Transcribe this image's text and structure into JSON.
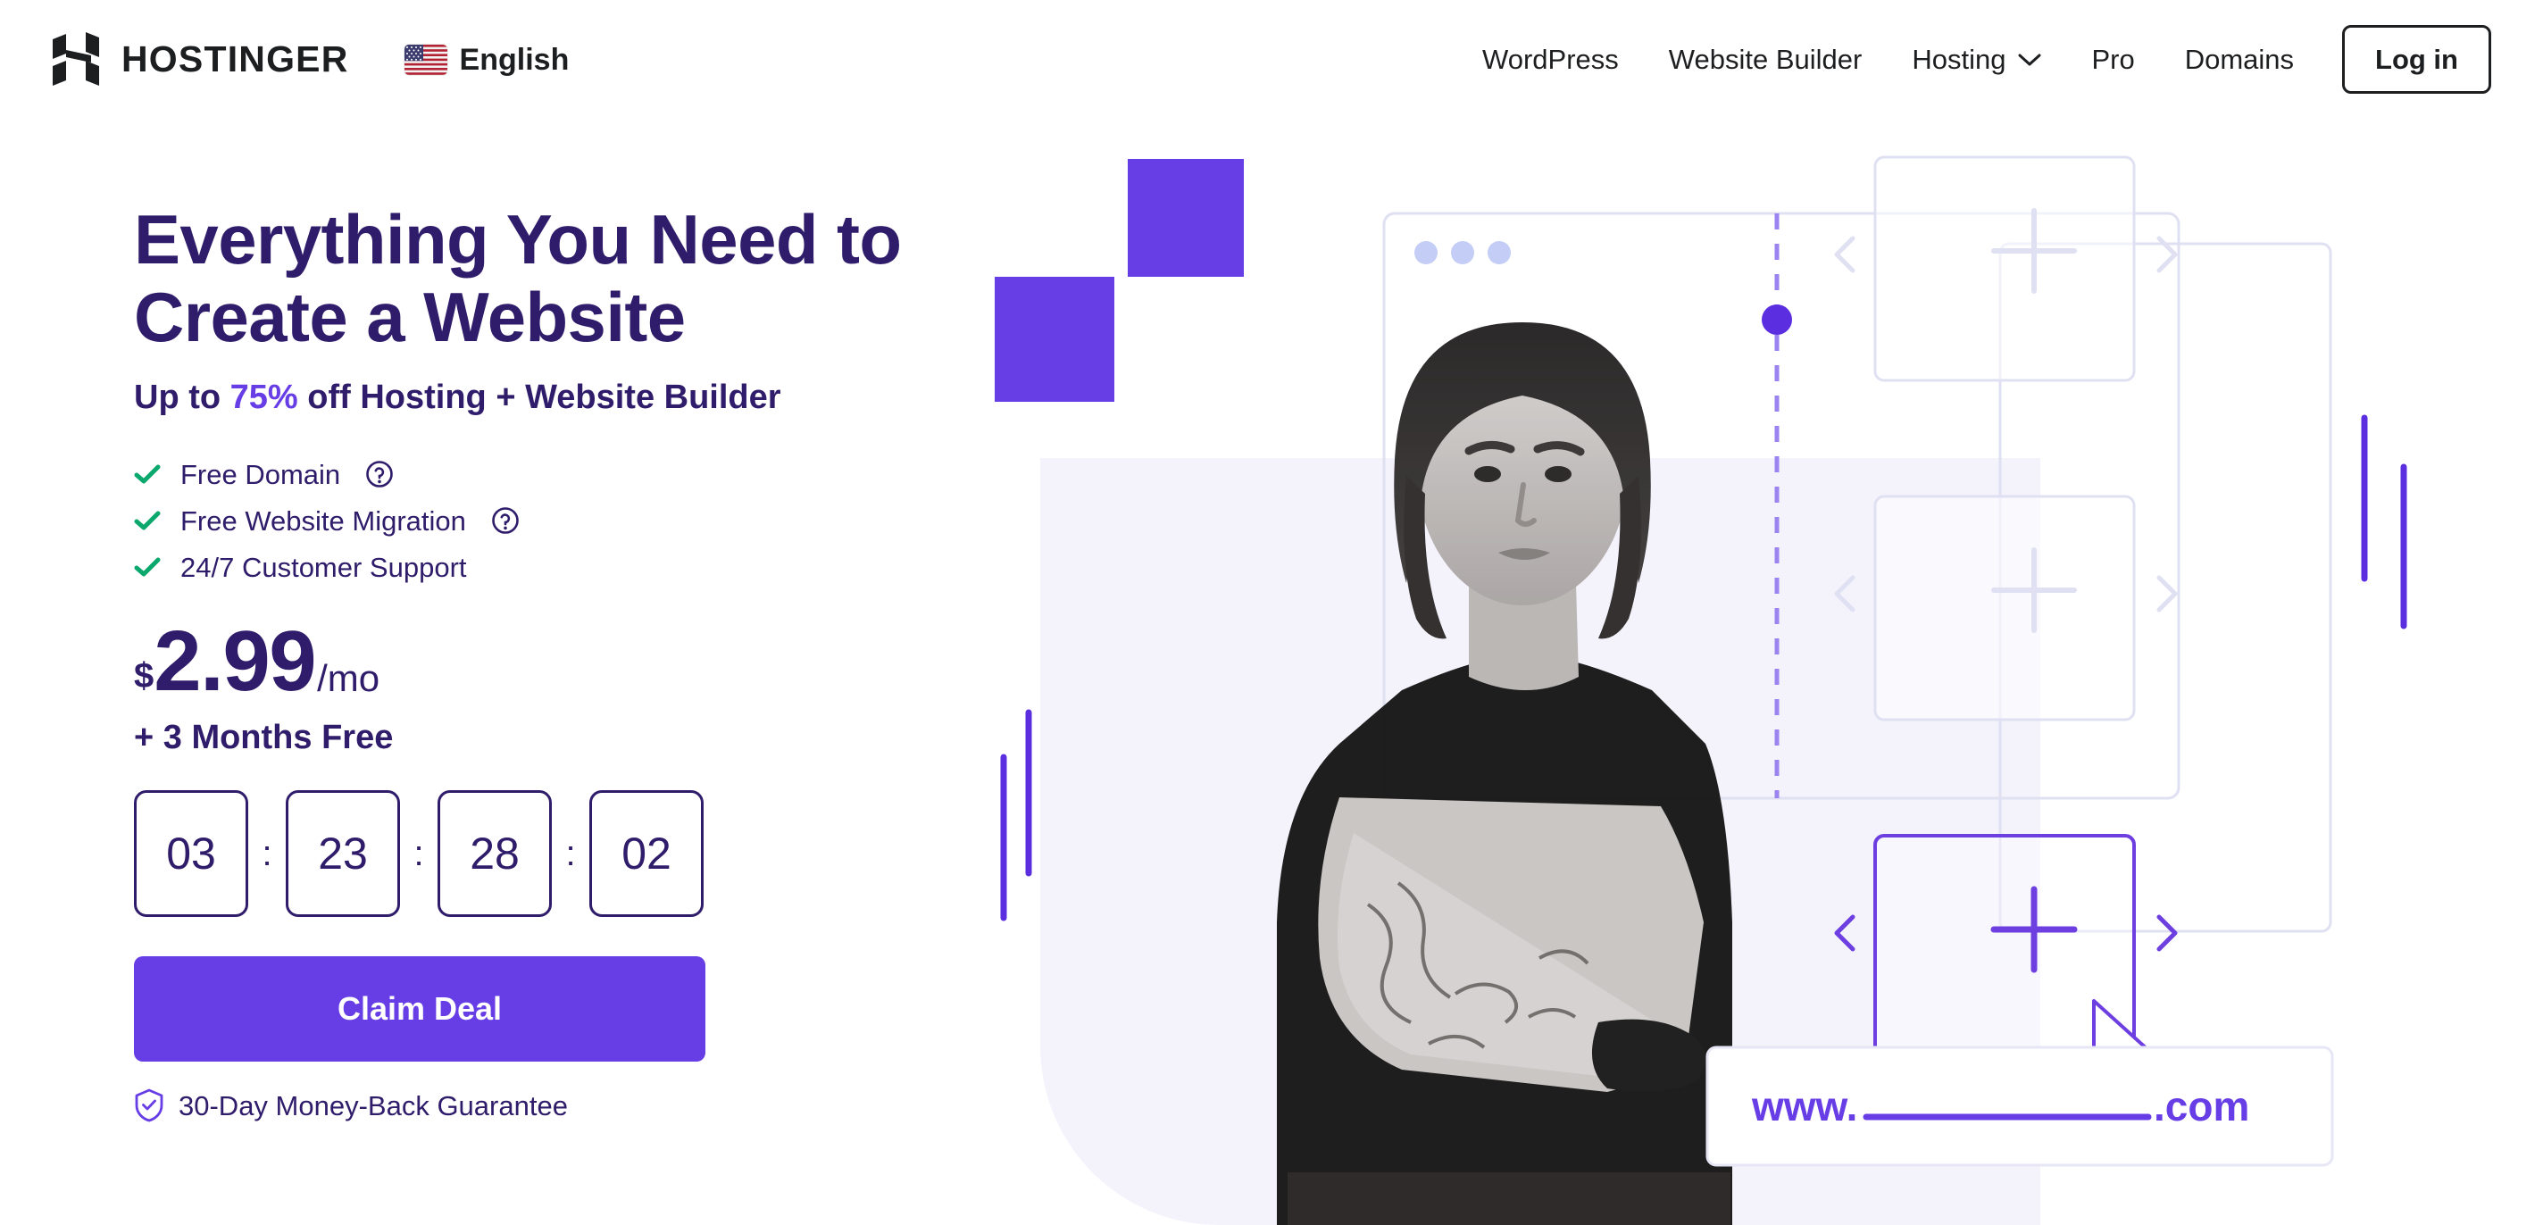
{
  "header": {
    "logo_icon": "hostinger-h-logo",
    "brand_name": "HOSTINGER",
    "language": {
      "flag_icon": "us-flag-icon",
      "label": "English"
    },
    "nav_items": [
      {
        "label": "WordPress",
        "has_dropdown": false
      },
      {
        "label": "Website Builder",
        "has_dropdown": false
      },
      {
        "label": "Hosting",
        "has_dropdown": true
      },
      {
        "label": "Pro",
        "has_dropdown": false
      },
      {
        "label": "Domains",
        "has_dropdown": false
      }
    ],
    "login_label": "Log in"
  },
  "hero": {
    "headline_line1": "Everything You Need to",
    "headline_line2": "Create a Website",
    "subhead_pre": "Up to ",
    "subhead_highlight": "75%",
    "subhead_post": " off Hosting + Website Builder",
    "features": [
      {
        "label": "Free Domain",
        "check_icon": "check-icon",
        "help_icon": "question-circle-icon",
        "has_help": true
      },
      {
        "label": "Free Website Migration",
        "check_icon": "check-icon",
        "help_icon": "question-circle-icon",
        "has_help": true
      },
      {
        "label": "24/7 Customer Support",
        "check_icon": "check-icon",
        "has_help": false
      }
    ],
    "price": {
      "currency": "$",
      "amount": "2.99",
      "period": "/mo"
    },
    "bonus": "+ 3 Months Free",
    "countdown": {
      "separator": ":",
      "units": [
        "03",
        "23",
        "28",
        "02"
      ]
    },
    "cta_label": "Claim Deal",
    "guarantee": {
      "shield_icon": "shield-check-icon",
      "label": "30-Day Money-Back Guarantee"
    }
  },
  "illustration": {
    "browser_dots_count": 3,
    "placeholder_cards": [
      {
        "plus_icon": "plus-icon",
        "prev_icon": "chevron-left-icon",
        "next_icon": "chevron-right-icon",
        "selected": false
      },
      {
        "plus_icon": "plus-icon",
        "prev_icon": "chevron-left-icon",
        "next_icon": "chevron-right-icon",
        "selected": false
      },
      {
        "plus_icon": "plus-icon",
        "prev_icon": "chevron-left-icon",
        "next_icon": "chevron-right-icon",
        "selected": true
      }
    ],
    "domain_bar": {
      "prefix": "www.",
      "suffix": ".com"
    },
    "cursor_icon": "mouse-pointer-icon",
    "person_photo": "woman-with-tattoos-photo"
  },
  "colors": {
    "brand_violet": "#673de6",
    "deep_purple": "#2f1c6a",
    "check_green": "#0ba86d",
    "ink": "#1d1e20",
    "lavender_wash": "#f4f3fc",
    "card_outline": "#e3e2f5",
    "dot_blue": "#c3cdf5"
  }
}
